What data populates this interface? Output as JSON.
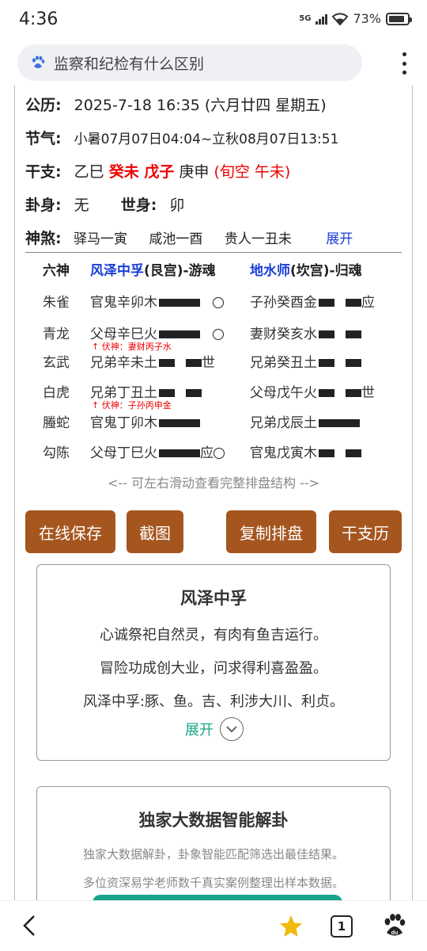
{
  "status": {
    "time": "4:36",
    "network": "5G",
    "battery": "73%"
  },
  "search": {
    "query": "监察和纪检有什么区别"
  },
  "info": {
    "gongli_label": "公历:",
    "gongli_value": "2025-7-18 16:35 (六月廿四 星期五)",
    "jieqi_label": "节气:",
    "jieqi_value": "小暑07月07日04:04~立秋08月07日13:51",
    "ganzhi_label": "干支:",
    "ganzhi_1": "乙巳",
    "ganzhi_2": "癸未 戊子",
    "ganzhi_3": "庚申",
    "ganzhi_xunkong": "(旬空 午未)",
    "guashen_label": "卦身:",
    "guashen_value": "无",
    "shishen_label": "世身:",
    "shishen_value": "卯",
    "shensha_label": "神煞:",
    "shensha_1": "驿马一寅",
    "shensha_2": "咸池一酉",
    "shensha_3": "贵人一丑未",
    "expand_label": "展开"
  },
  "table": {
    "header": {
      "liushen": "六神",
      "ben_gua": "风泽中孚",
      "ben_gua_suffix": "(艮宫)-游魂",
      "bian_gua": "地水师",
      "bian_gua_suffix": "(坎宫)-归魂"
    },
    "rows": [
      {
        "liushen": "朱雀",
        "ben": "官鬼辛卯木",
        "ben_tail": "",
        "bian": "子孙癸酉金",
        "bian_tail": "应"
      },
      {
        "liushen": "青龙",
        "ben": "父母辛巳火",
        "ben_tail": "",
        "bian": "妻财癸亥水",
        "bian_tail": "",
        "fushen": "↑ 伏神：妻财丙子水"
      },
      {
        "liushen": "玄武",
        "ben": "兄弟辛未土",
        "ben_tail": "世",
        "bian": "兄弟癸丑土",
        "bian_tail": ""
      },
      {
        "liushen": "白虎",
        "ben": "兄弟丁丑土",
        "ben_tail": "",
        "bian": "父母戊午火",
        "bian_tail": "世",
        "fushen": "↑ 伏神：子孙丙申金"
      },
      {
        "liushen": "螣蛇",
        "ben": "官鬼丁卯木",
        "ben_tail": "",
        "bian": "兄弟戊辰土",
        "bian_tail": ""
      },
      {
        "liushen": "勾陈",
        "ben": "父母丁巳火",
        "ben_tail": "应",
        "bian": "官鬼戊寅木",
        "bian_tail": ""
      }
    ]
  },
  "hint": "<-- 可左右滑动查看完整排盘结构 -->",
  "buttons": {
    "save": "在线保存",
    "screenshot": "截图",
    "copy": "复制排盘",
    "ganzhi": "干支历"
  },
  "card1": {
    "title": "风泽中孚",
    "line1": "心诚祭祀自然灵，有肉有鱼吉运行。",
    "line2": "冒险功成创大业，问求得利喜盈盈。",
    "line3": "风泽中孚:豚、鱼。吉、利涉大川、利贞。",
    "expand": "展开"
  },
  "card2": {
    "title": "独家大数据智能解卦",
    "line1": "独家大数据解卦，卦象智能匹配筛选出最佳结果。",
    "line2": "多位资深易学老师数千真实案例整理出样本数据。"
  },
  "nav": {
    "tabs_count": "1"
  },
  "colors": {
    "accent_brown": "#a5561f",
    "red": "#e00000",
    "blue": "#1a3fd6",
    "teal": "#19a58b"
  }
}
